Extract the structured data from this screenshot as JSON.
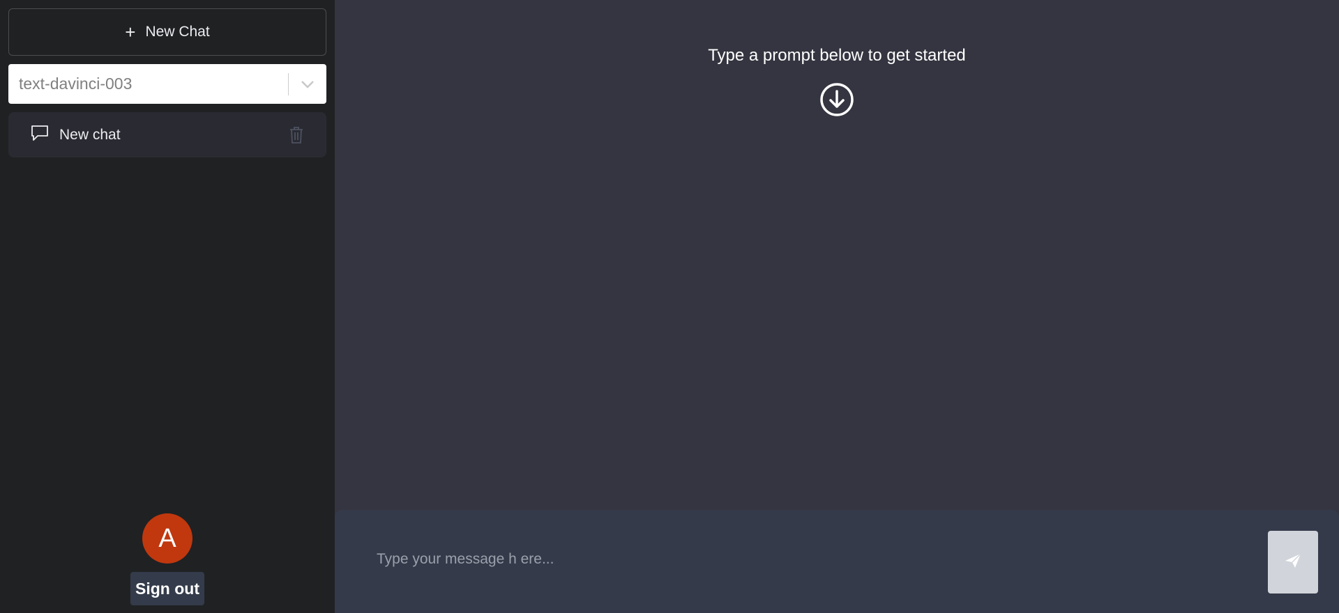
{
  "sidebar": {
    "new_chat_label": "New Chat",
    "model_select": {
      "value": "text-davinci-003"
    },
    "conversations": [
      {
        "label": "New chat"
      }
    ],
    "avatar_initial": "A",
    "sign_out_label": "Sign out"
  },
  "main": {
    "empty_state_text": "Type a prompt below to get started",
    "input_placeholder": "Type your message h ere...",
    "input_value": ""
  },
  "icons": {
    "plus": "plus-icon",
    "chevron": "chevron-down-icon",
    "chat": "chat-bubble-icon",
    "trash": "trash-icon",
    "down": "arrow-down-circle-icon",
    "send": "send-icon"
  },
  "colors": {
    "sidebar_bg": "#202123",
    "main_bg": "#353541",
    "input_bar_bg": "#353a4a",
    "avatar_bg": "#c1380e",
    "send_button_bg": "#d1d5db"
  }
}
